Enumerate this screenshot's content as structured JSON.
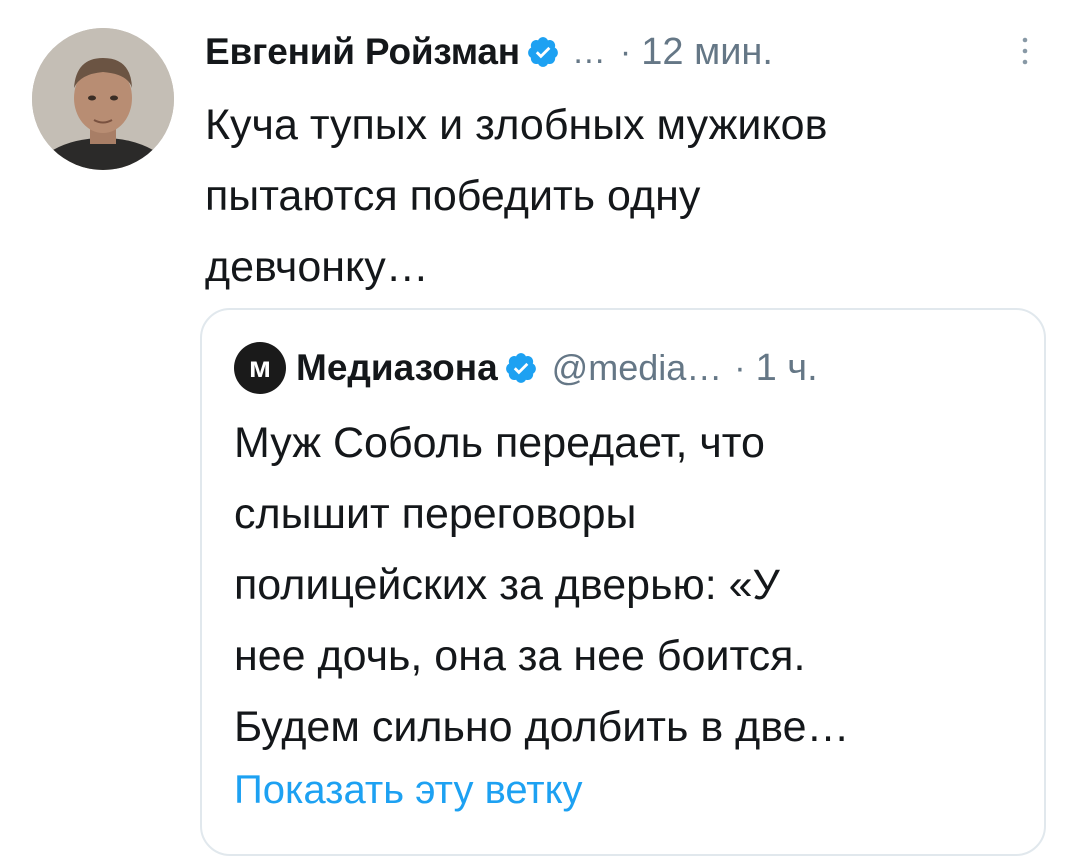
{
  "tweet": {
    "author_name": "Евгений Ройзман",
    "handle_truncated": "…",
    "separator": "·",
    "time": "12 мин.",
    "text_lines": [
      "Куча тупых и злобных мужиков",
      "пытаются победить одну",
      "девчонку…"
    ],
    "more_icon": "more-vertical-icon",
    "verified_icon": "verified-badge-icon"
  },
  "quote": {
    "avatar_letter": "м",
    "author_name": "Медиазона",
    "handle": "@media…",
    "separator": "·",
    "time": "1 ч.",
    "text_lines": [
      "Муж Соболь передает, что",
      "слышит переговоры",
      "полицейских за дверью: «У",
      "нее дочь, она за нее боится.",
      "Будем сильно долбить в две…"
    ],
    "show_thread": "Показать эту ветку"
  },
  "colors": {
    "text": "#14171a",
    "secondary": "#657786",
    "accent": "#1da1f2",
    "border": "#e1e8ed"
  }
}
